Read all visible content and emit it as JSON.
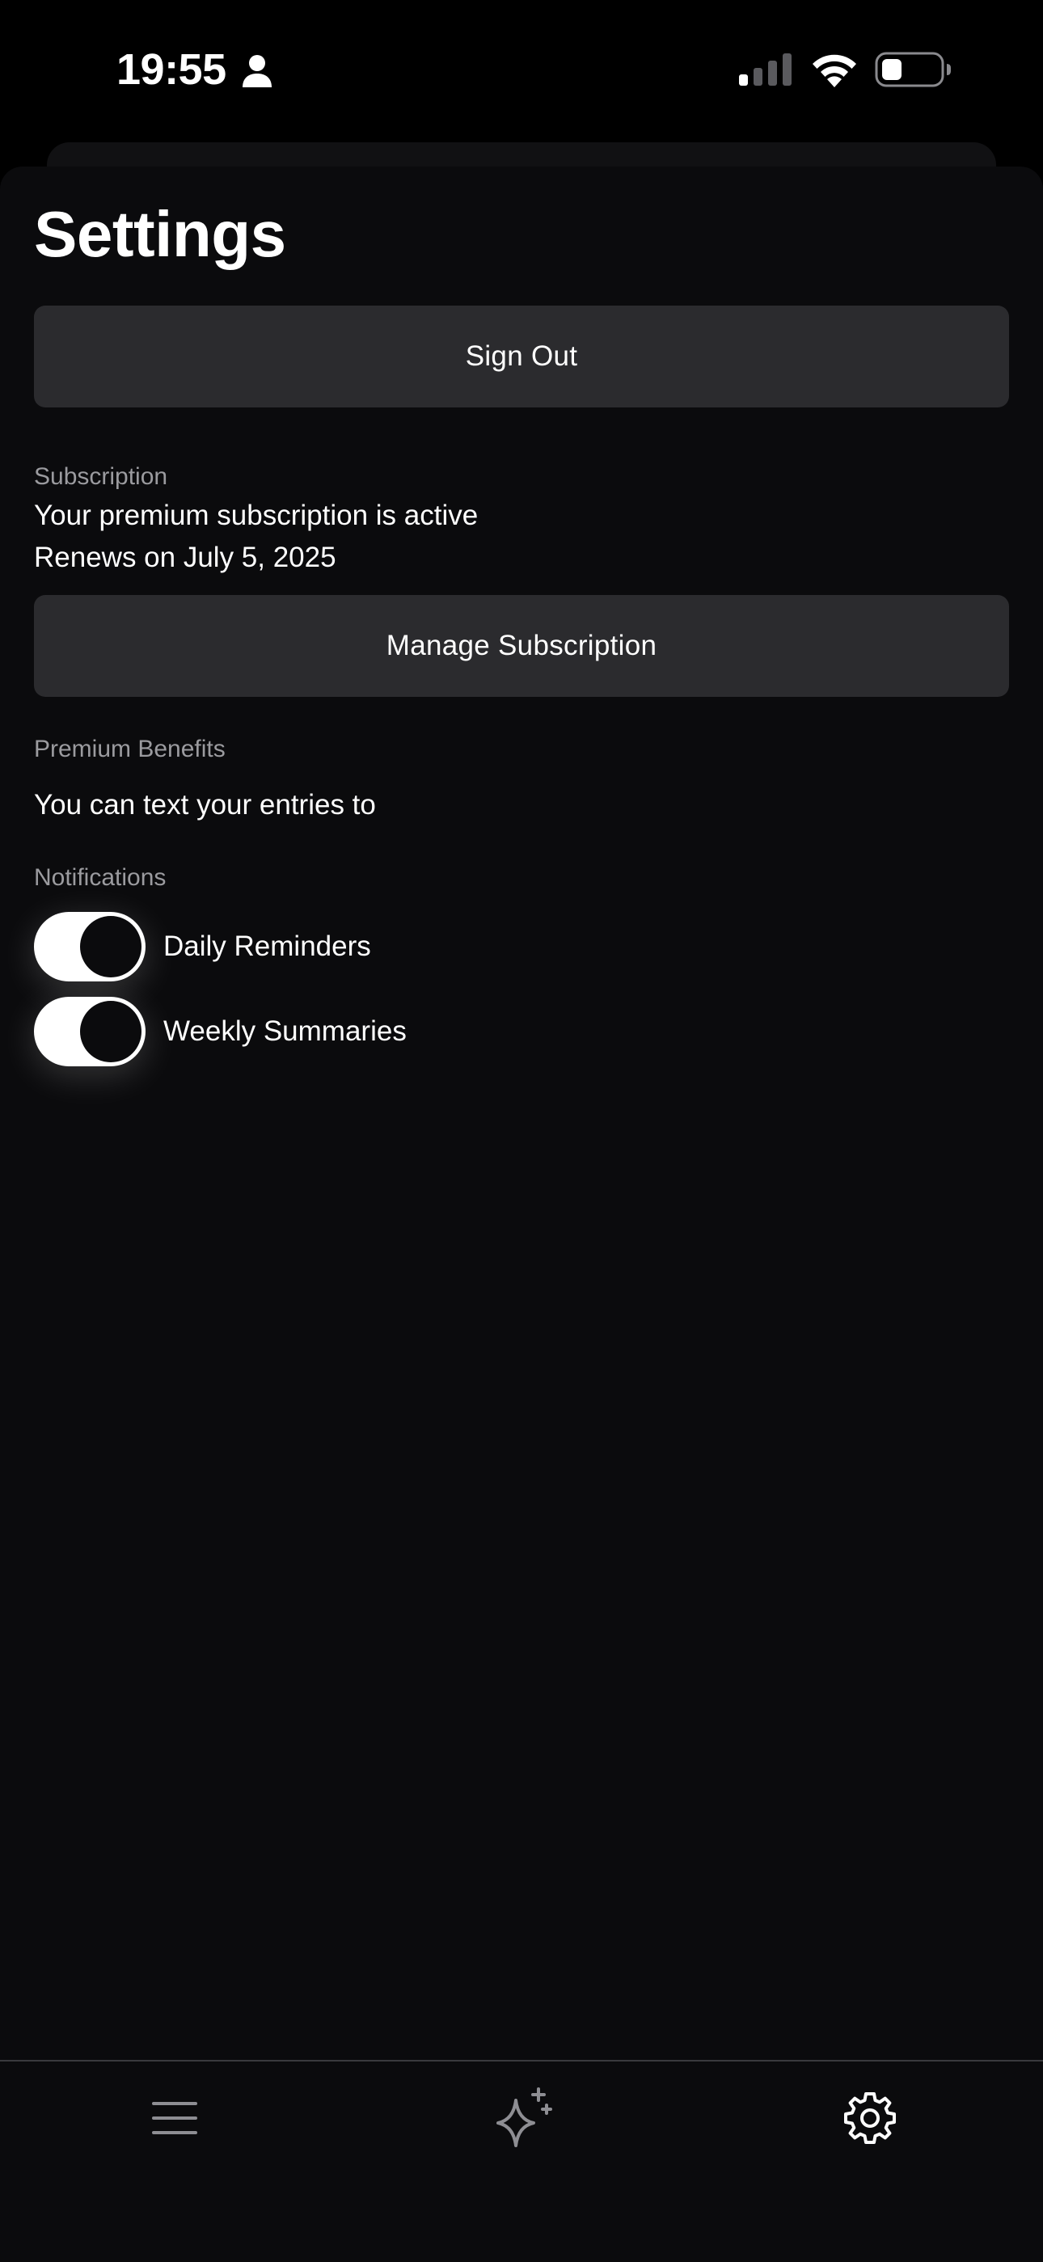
{
  "status_bar": {
    "time": "19:55",
    "icons": [
      "person-icon",
      "cellular-signal-icon",
      "wifi-icon",
      "battery-icon"
    ]
  },
  "page": {
    "title": "Settings"
  },
  "account": {
    "sign_out_label": "Sign Out"
  },
  "subscription": {
    "section_label": "Subscription",
    "status_text": "Your premium subscription is active",
    "renewal_text": "Renews on July 5, 2025",
    "manage_label": "Manage Subscription"
  },
  "premium_benefits": {
    "section_label": "Premium Benefits",
    "text": "You can text your entries to"
  },
  "notifications": {
    "section_label": "Notifications",
    "items": [
      {
        "label": "Daily Reminders",
        "enabled": true
      },
      {
        "label": "Weekly Summaries",
        "enabled": true
      }
    ]
  },
  "tab_bar": {
    "tabs": [
      {
        "icon": "list-icon",
        "active": false
      },
      {
        "icon": "sparkle-icon",
        "active": false
      },
      {
        "icon": "gear-icon",
        "active": true
      }
    ]
  },
  "colors": {
    "background": "#0b0b0d",
    "button_background": "#2b2b2e",
    "secondary_text": "#9b9b9f",
    "text": "#ffffff"
  }
}
